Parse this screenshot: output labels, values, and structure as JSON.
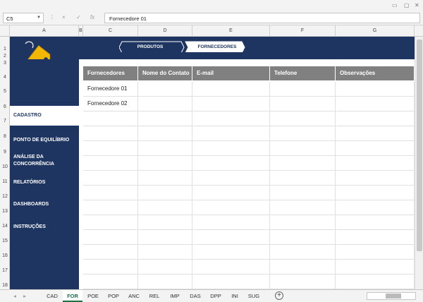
{
  "window": {
    "restore_icon": "restore-icon",
    "minimize_icon": "minimize-icon"
  },
  "formula_bar": {
    "name_box": "C5",
    "cancel_icon": "×",
    "enter_icon": "✓",
    "fx_label": "fx",
    "formula_value": "Fornecedore 01"
  },
  "columns": [
    "A",
    "B",
    "C",
    "D",
    "E",
    "F",
    "G"
  ],
  "rows": [
    "1",
    "2",
    "3",
    "4",
    "5",
    "6",
    "7",
    "8",
    "9",
    "10",
    "11",
    "12",
    "13",
    "14",
    "15",
    "16",
    "17",
    "18"
  ],
  "header_tabs": {
    "produtos": "PRODUTOS",
    "fornecedores": "FORNECEDORES"
  },
  "sidebar": {
    "active": "CADASTRO",
    "items": [
      {
        "label": "PONTO DE EQUILÍBRIO"
      },
      {
        "label": "ANÁLISE DA"
      },
      {
        "label": "CONCORRÊNCIA"
      },
      {
        "label": "RELATÓRIOS"
      },
      {
        "label": "DASHBOARDS"
      },
      {
        "label": "INSTRUÇÕES"
      }
    ]
  },
  "table": {
    "headers": [
      "Fornecedores",
      "Nome do Contato",
      "E-mail",
      "Telefone",
      "Observações"
    ],
    "rows": [
      [
        "Fornecedore 01",
        "",
        "",
        "",
        ""
      ],
      [
        "Fornecedore 02",
        "",
        "",
        "",
        ""
      ]
    ]
  },
  "sheet_tabs": [
    "CAD",
    "FOR",
    "POE",
    "POP",
    "ANC",
    "REL",
    "IMP",
    "DAS",
    "DPP",
    "INI",
    "SUG"
  ],
  "active_sheet": "FOR",
  "add_sheet": "+",
  "colors": {
    "navy": "#1f3561",
    "header_gray": "#808080",
    "tag_gold": "#f2b705",
    "excel_green": "#1e7145"
  }
}
